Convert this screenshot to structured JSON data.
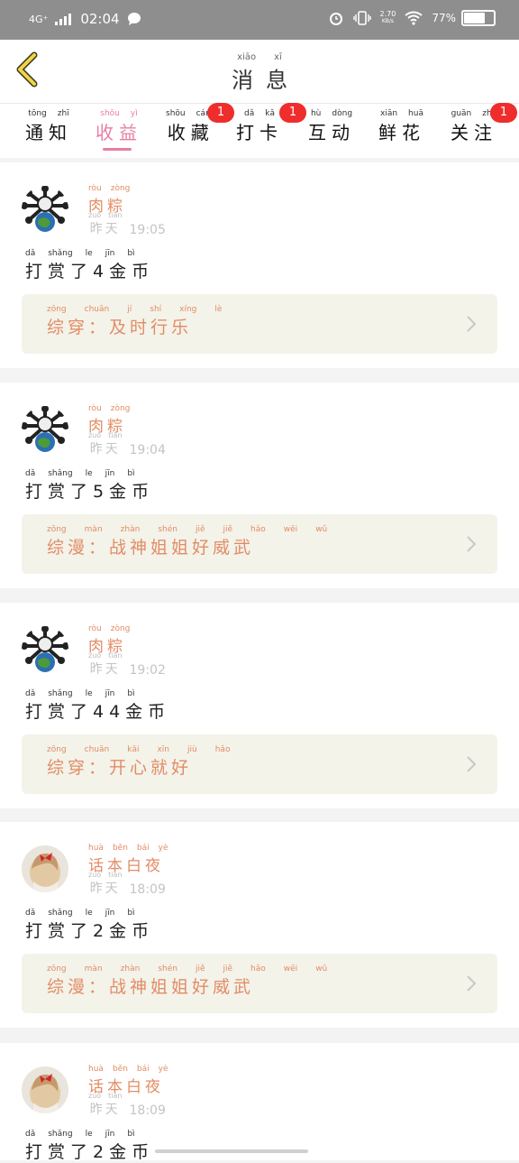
{
  "status": {
    "network": "4G⁺",
    "time": "02:04",
    "net_speed_value": "2.70",
    "net_speed_unit": "KB/s",
    "battery": "77%"
  },
  "header": {
    "title_pinyin": [
      "xiāo",
      "xī"
    ],
    "title": "消息"
  },
  "tabs": [
    {
      "py": [
        "tōng",
        "zhī"
      ],
      "cn": "通知",
      "badge": ""
    },
    {
      "py": [
        "shōu",
        "yì"
      ],
      "cn": "收益",
      "badge": ""
    },
    {
      "py": [
        "shōu",
        "cáng"
      ],
      "cn": "收藏",
      "badge": "1"
    },
    {
      "py": [
        "dǎ",
        "kǎ"
      ],
      "cn": "打卡",
      "badge": "1"
    },
    {
      "py": [
        "hù",
        "dòng"
      ],
      "cn": "互动",
      "badge": ""
    },
    {
      "py": [
        "xiān",
        "huā"
      ],
      "cn": "鲜花",
      "badge": ""
    },
    {
      "py": [
        "guān",
        "zhù"
      ],
      "cn": "关注",
      "badge": "1"
    }
  ],
  "items": [
    {
      "user_py": [
        "ròu",
        "zòng"
      ],
      "user": "肉粽",
      "day_py": [
        "zuó",
        "tiān"
      ],
      "day": "昨天",
      "time": "19:05",
      "tip_py": [
        "dǎ",
        "shǎng",
        "le",
        "jīn",
        "bì"
      ],
      "tip": "打赏了4金币",
      "link_py": [
        "zōng",
        "chuān",
        "jí",
        "shí",
        "xíng",
        "lè"
      ],
      "link": "综穿：及时行乐"
    },
    {
      "user_py": [
        "ròu",
        "zòng"
      ],
      "user": "肉粽",
      "day_py": [
        "zuó",
        "tiān"
      ],
      "day": "昨天",
      "time": "19:04",
      "tip_py": [
        "dǎ",
        "shǎng",
        "le",
        "jīn",
        "bì"
      ],
      "tip": "打赏了5金币",
      "link_py": [
        "zōng",
        "màn",
        "zhàn",
        "shén",
        "jiě",
        "jiě",
        "hǎo",
        "wēi",
        "wǔ"
      ],
      "link": "综漫：战神姐姐好威武"
    },
    {
      "user_py": [
        "ròu",
        "zòng"
      ],
      "user": "肉粽",
      "day_py": [
        "zuó",
        "tiān"
      ],
      "day": "昨天",
      "time": "19:02",
      "tip_py": [
        "dǎ",
        "shǎng",
        "le",
        "jīn",
        "bì"
      ],
      "tip": "打赏了44金币",
      "link_py": [
        "zōng",
        "chuān",
        "kāi",
        "xīn",
        "jiù",
        "hǎo"
      ],
      "link": "综穿：开心就好"
    },
    {
      "user_py": [
        "huà",
        "běn",
        "bái",
        "yè"
      ],
      "user": "话本白夜",
      "day_py": [
        "zuó",
        "tiān"
      ],
      "day": "昨天",
      "time": "18:09",
      "tip_py": [
        "dǎ",
        "shǎng",
        "le",
        "jīn",
        "bì"
      ],
      "tip": "打赏了2金币",
      "link_py": [
        "zōng",
        "màn",
        "zhàn",
        "shén",
        "jiě",
        "jiě",
        "hǎo",
        "wēi",
        "wǔ"
      ],
      "link": "综漫：战神姐姐好威武"
    },
    {
      "user_py": [
        "huà",
        "běn",
        "bái",
        "yè"
      ],
      "user": "话本白夜",
      "day_py": [
        "zuó",
        "tiān"
      ],
      "day": "昨天",
      "time": "18:09",
      "tip_py": [
        "dǎ",
        "shǎng",
        "le",
        "jīn",
        "bì"
      ],
      "tip": "打赏了2金币",
      "link_py": [],
      "link": ""
    }
  ],
  "colors": {
    "accent": "#e77ea6",
    "name": "#e38c65",
    "badge": "#ef2d2d"
  }
}
